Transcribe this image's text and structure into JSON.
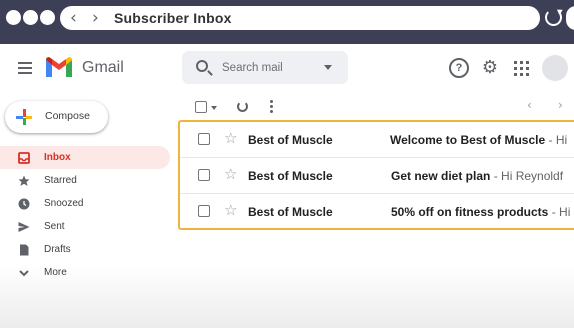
{
  "browser": {
    "tab_title": "Subscriber Inbox",
    "back_icon": "chevron-left-icon",
    "forward_icon": "chevron-right-icon",
    "reload_icon": "reload-icon"
  },
  "header": {
    "app_name": "Gmail",
    "search_placeholder": "Search mail",
    "icons": [
      "menu-icon",
      "search-icon",
      "help-icon",
      "settings-icon",
      "apps-icon",
      "avatar"
    ]
  },
  "compose": {
    "label": "Compose"
  },
  "sidebar": {
    "items": [
      {
        "label": "Inbox",
        "icon": "inbox-icon",
        "active": true
      },
      {
        "label": "Starred",
        "icon": "star-icon",
        "active": false
      },
      {
        "label": "Snoozed",
        "icon": "clock-icon",
        "active": false
      },
      {
        "label": "Sent",
        "icon": "send-icon",
        "active": false
      },
      {
        "label": "Drafts",
        "icon": "draft-icon",
        "active": false
      },
      {
        "label": "More",
        "icon": "chevron-down-icon",
        "active": false
      }
    ]
  },
  "emails": [
    {
      "sender": "Best of Muscle",
      "subject": "Welcome to Best of Muscle",
      "snippet": " - Hi"
    },
    {
      "sender": "Best of Muscle",
      "subject": "Get new diet plan",
      "snippet": " - Hi Reynoldf"
    },
    {
      "sender": "Best of Muscle",
      "subject": "50% off on fitness products",
      "snippet": " - Hi"
    }
  ],
  "colors": {
    "chrome": "#3c3f55",
    "inbox_active_bg": "#fce8e6",
    "inbox_active_text": "#d93025",
    "highlight_border": "#f2b33d"
  }
}
